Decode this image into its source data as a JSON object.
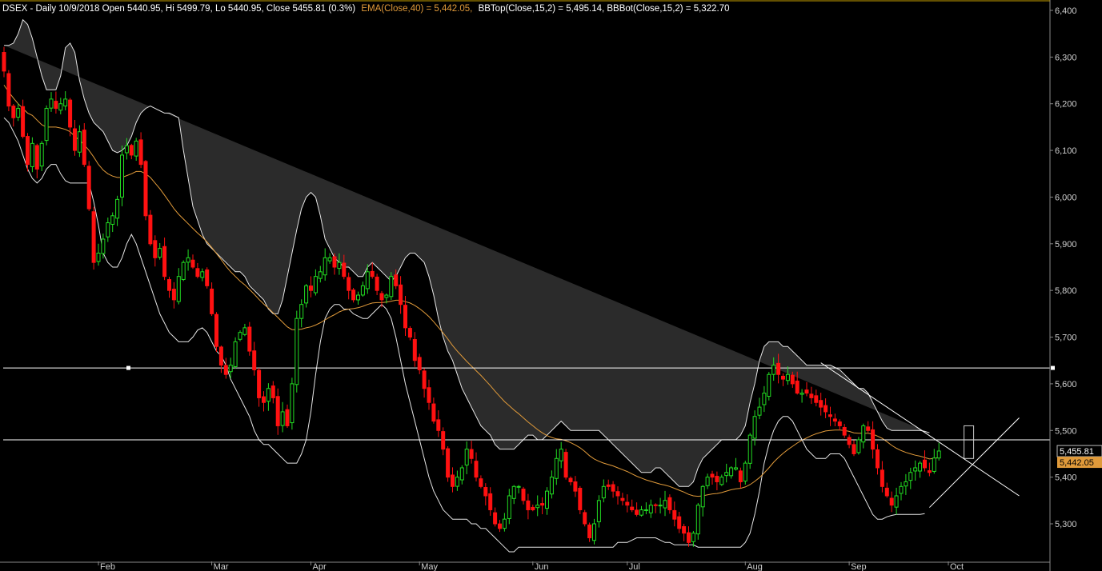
{
  "header": {
    "symbol_info": "DSEX - Daily 10/9/2018 Open 5440.95, Hi 5499.79, Lo 5440.95, Close 5455.81 (0.3%)",
    "ema_info": "EMA(Close,40) = 5,442.05,",
    "bb_info": "BBTop(Close,15,2) = 5,495.14, BBBot(Close,15,2) = 5,322.70"
  },
  "colors": {
    "background": "#000000",
    "bullish": "#22dd22",
    "bearish": "#ff1111",
    "ema": "#e09a3a",
    "band_fill": "#2b2b2b",
    "band_line": "#e6e6e6",
    "axis_text": "#cfcfcf",
    "line_white": "#ffffff"
  },
  "price_labels": {
    "close": "5,455.81",
    "ema": "5,442.05"
  },
  "chart_data": {
    "type": "candlestick",
    "y_ticks": [
      "6,400",
      "6,300",
      "6,200",
      "6,100",
      "6,000",
      "5,900",
      "5,800",
      "5,700",
      "5,600",
      "5,500",
      "5,400",
      "5,300"
    ],
    "y_range": [
      5220,
      6410
    ],
    "x_labels": [
      "Feb",
      "Mar",
      "Apr",
      "May",
      "Jun",
      "Jul",
      "Aug",
      "Sep",
      "Oct"
    ],
    "x_label_index": [
      20,
      44,
      65,
      88,
      112,
      132,
      157,
      179,
      200
    ],
    "n_bars": 206,
    "horizontal_lines": [
      5634,
      5480
    ],
    "trendlines": [
      {
        "from": [
          173,
          5645
        ],
        "to": [
          215,
          5360
        ]
      },
      {
        "from": [
          196,
          5335
        ],
        "to": [
          215,
          5527
        ]
      }
    ],
    "highlight_bar": 204,
    "close": [
      6270,
      6195,
      6170,
      6190,
      6130,
      6070,
      6115,
      6060,
      6115,
      6190,
      6210,
      6190,
      6200,
      6210,
      6150,
      6100,
      6140,
      6070,
      5975,
      5860,
      5880,
      5910,
      5945,
      5960,
      5995,
      6090,
      6110,
      6090,
      6120,
      6070,
      5960,
      5900,
      5870,
      5890,
      5830,
      5800,
      5780,
      5830,
      5860,
      5870,
      5850,
      5830,
      5840,
      5810,
      5750,
      5680,
      5640,
      5620,
      5640,
      5690,
      5710,
      5720,
      5670,
      5630,
      5570,
      5560,
      5590,
      5570,
      5510,
      5540,
      5510,
      5600,
      5740,
      5770,
      5810,
      5800,
      5830,
      5840,
      5870,
      5870,
      5850,
      5860,
      5830,
      5800,
      5780,
      5790,
      5810,
      5840,
      5830,
      5800,
      5780,
      5790,
      5830,
      5810,
      5770,
      5720,
      5700,
      5650,
      5630,
      5590,
      5560,
      5520,
      5500,
      5460,
      5400,
      5380,
      5400,
      5420,
      5460,
      5440,
      5400,
      5380,
      5360,
      5330,
      5300,
      5290,
      5310,
      5360,
      5380,
      5380,
      5350,
      5330,
      5330,
      5340,
      5340,
      5370,
      5400,
      5440,
      5460,
      5400,
      5390,
      5370,
      5330,
      5300,
      5270,
      5300,
      5350,
      5380,
      5380,
      5370,
      5360,
      5350,
      5340,
      5330,
      5320,
      5330,
      5330,
      5340,
      5340,
      5340,
      5350,
      5330,
      5310,
      5290,
      5280,
      5260,
      5280,
      5340,
      5380,
      5400,
      5400,
      5390,
      5400,
      5410,
      5420,
      5420,
      5390,
      5430,
      5490,
      5530,
      5550,
      5580,
      5620,
      5640,
      5620,
      5610,
      5620,
      5600,
      5580,
      5580,
      5580,
      5570,
      5560,
      5550,
      5540,
      5530,
      5520,
      5510,
      5490,
      5470,
      5450,
      5480,
      5510,
      5500,
      5460,
      5420,
      5380,
      5360,
      5340,
      5360,
      5380,
      5390,
      5410,
      5420,
      5430,
      5420,
      5410,
      5441,
      5456
    ],
    "ema": [
      6240,
      6225,
      6212,
      6200,
      6190,
      6180,
      6175,
      6165,
      6155,
      6150,
      6150,
      6150,
      6148,
      6145,
      6140,
      6130,
      6122,
      6112,
      6100,
      6086,
      6070,
      6058,
      6050,
      6045,
      6042,
      6042,
      6046,
      6050,
      6055,
      6055,
      6050,
      6042,
      6030,
      6018,
      6004,
      5990,
      5975,
      5963,
      5953,
      5943,
      5933,
      5923,
      5914,
      5904,
      5892,
      5879,
      5866,
      5852,
      5840,
      5830,
      5820,
      5812,
      5802,
      5792,
      5781,
      5771,
      5762,
      5752,
      5742,
      5732,
      5722,
      5716,
      5716,
      5717,
      5720,
      5722,
      5726,
      5731,
      5737,
      5743,
      5748,
      5754,
      5758,
      5760,
      5761,
      5763,
      5766,
      5770,
      5773,
      5774,
      5774,
      5775,
      5777,
      5779,
      5779,
      5776,
      5773,
      5768,
      5761,
      5753,
      5744,
      5733,
      5721,
      5709,
      5696,
      5682,
      5670,
      5659,
      5648,
      5638,
      5628,
      5618,
      5607,
      5596,
      5584,
      5573,
      5562,
      5553,
      5544,
      5536,
      5527,
      5518,
      5510,
      5502,
      5495,
      5489,
      5485,
      5482,
      5481,
      5478,
      5474,
      5469,
      5463,
      5455,
      5446,
      5439,
      5434,
      5430,
      5427,
      5424,
      5420,
      5416,
      5412,
      5407,
      5402,
      5398,
      5394,
      5391,
      5388,
      5385,
      5383,
      5380,
      5376,
      5372,
      5368,
      5363,
      5360,
      5359,
      5360,
      5362,
      5364,
      5365,
      5367,
      5370,
      5373,
      5375,
      5376,
      5379,
      5384,
      5391,
      5399,
      5409,
      5420,
      5432,
      5442,
      5451,
      5459,
      5466,
      5473,
      5479,
      5484,
      5489,
      5493,
      5496,
      5499,
      5500,
      5501,
      5501,
      5500,
      5498,
      5495,
      5494,
      5494,
      5494,
      5492,
      5488,
      5483,
      5476,
      5468,
      5462,
      5457,
      5453,
      5450,
      5447,
      5445,
      5442,
      5439,
      5440,
      5442
    ],
    "bb_top": [
      6325,
      6325,
      6330,
      6350,
      6380,
      6370,
      6340,
      6300,
      6260,
      6230,
      6230,
      6230,
      6260,
      6320,
      6330,
      6310,
      6250,
      6210,
      6180,
      6160,
      6150,
      6140,
      6120,
      6100,
      6095,
      6100,
      6110,
      6130,
      6160,
      6180,
      6190,
      6195,
      6190,
      6185,
      6180,
      6180,
      6175,
      6170,
      6100,
      6040,
      5980,
      5950,
      5920,
      5900,
      5890,
      5880,
      5870,
      5860,
      5850,
      5840,
      5840,
      5830,
      5810,
      5800,
      5790,
      5780,
      5760,
      5750,
      5750,
      5780,
      5830,
      5880,
      5930,
      5975,
      6000,
      6010,
      6000,
      5960,
      5910,
      5890,
      5870,
      5860,
      5850,
      5850,
      5840,
      5830,
      5830,
      5850,
      5860,
      5850,
      5840,
      5830,
      5820,
      5830,
      5850,
      5870,
      5880,
      5880,
      5870,
      5860,
      5830,
      5790,
      5740,
      5700,
      5670,
      5650,
      5620,
      5590,
      5570,
      5550,
      5530,
      5510,
      5500,
      5490,
      5470,
      5460,
      5460,
      5460,
      5460,
      5470,
      5480,
      5490,
      5490,
      5480,
      5480,
      5490,
      5500,
      5510,
      5520,
      5510,
      5500,
      5500,
      5500,
      5500,
      5500,
      5500,
      5500,
      5490,
      5480,
      5470,
      5460,
      5450,
      5440,
      5430,
      5420,
      5410,
      5410,
      5410,
      5420,
      5420,
      5410,
      5400,
      5390,
      5380,
      5380,
      5380,
      5390,
      5420,
      5440,
      5450,
      5460,
      5470,
      5480,
      5480,
      5480,
      5480,
      5490,
      5510,
      5560,
      5600,
      5650,
      5680,
      5690,
      5690,
      5690,
      5680,
      5680,
      5670,
      5660,
      5650,
      5640,
      5640,
      5640,
      5640,
      5640,
      5640,
      5635,
      5630,
      5620,
      5610,
      5600,
      5590,
      5590,
      5580,
      5560,
      5540,
      5520,
      5505,
      5500,
      5500,
      5500,
      5500,
      5500,
      5500,
      5500,
      5498,
      5495
    ],
    "bb_bot": [
      6170,
      6160,
      6140,
      6120,
      6090,
      6060,
      6040,
      6030,
      6040,
      6060,
      6070,
      6070,
      6050,
      6035,
      6030,
      6030,
      6030,
      6030,
      6030,
      5990,
      5940,
      5880,
      5860,
      5850,
      5850,
      5870,
      5900,
      5920,
      5900,
      5870,
      5840,
      5810,
      5780,
      5750,
      5730,
      5710,
      5700,
      5690,
      5690,
      5690,
      5700,
      5715,
      5720,
      5710,
      5690,
      5670,
      5660,
      5640,
      5610,
      5590,
      5570,
      5550,
      5530,
      5500,
      5480,
      5470,
      5470,
      5460,
      5450,
      5440,
      5430,
      5430,
      5430,
      5450,
      5480,
      5540,
      5620,
      5690,
      5740,
      5760,
      5770,
      5770,
      5760,
      5760,
      5750,
      5745,
      5740,
      5740,
      5750,
      5760,
      5770,
      5760,
      5740,
      5700,
      5650,
      5600,
      5560,
      5520,
      5480,
      5440,
      5400,
      5370,
      5350,
      5330,
      5320,
      5310,
      5310,
      5310,
      5310,
      5300,
      5300,
      5290,
      5290,
      5280,
      5270,
      5260,
      5250,
      5240,
      5240,
      5250,
      5250,
      5250,
      5250,
      5250,
      5250,
      5250,
      5250,
      5250,
      5250,
      5250,
      5250,
      5250,
      5250,
      5250,
      5250,
      5250,
      5250,
      5250,
      5250,
      5250,
      5260,
      5260,
      5260,
      5265,
      5270,
      5270,
      5270,
      5270,
      5270,
      5265,
      5260,
      5260,
      5255,
      5255,
      5255,
      5255,
      5255,
      5250,
      5250,
      5250,
      5250,
      5250,
      5250,
      5250,
      5250,
      5250,
      5250,
      5260,
      5280,
      5320,
      5370,
      5430,
      5470,
      5500,
      5520,
      5530,
      5530,
      5520,
      5500,
      5480,
      5460,
      5450,
      5440,
      5440,
      5440,
      5450,
      5450,
      5450,
      5440,
      5420,
      5400,
      5380,
      5360,
      5340,
      5320,
      5310,
      5310,
      5315,
      5318,
      5320,
      5320,
      5320,
      5320,
      5320,
      5320,
      5322
    ]
  }
}
